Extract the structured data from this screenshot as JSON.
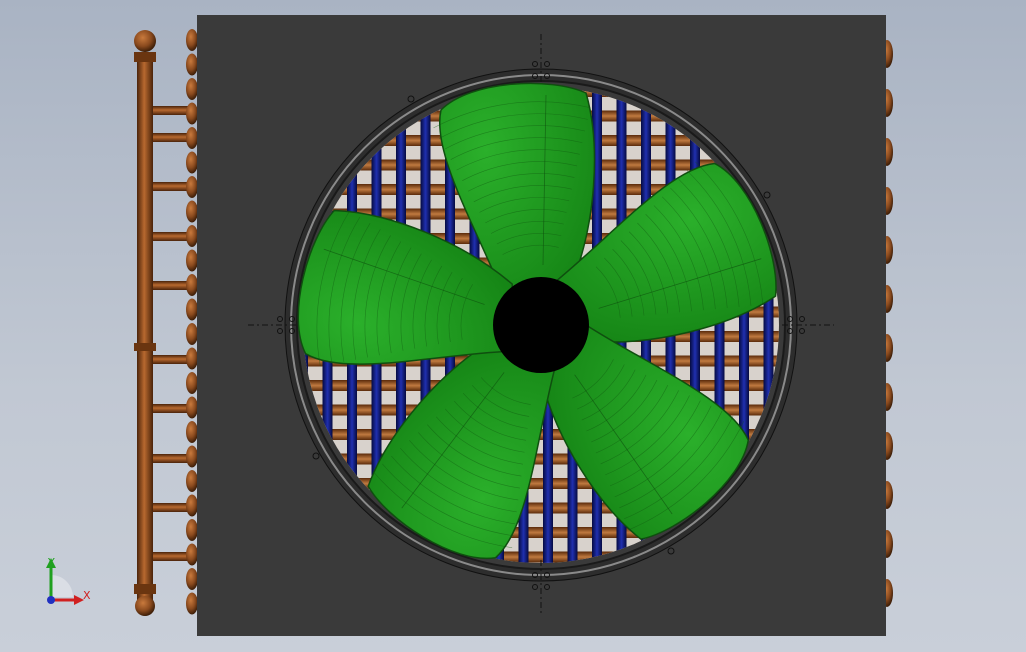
{
  "viewport": {
    "background_top": "#a9b3c3",
    "background_bottom": "#c9cfd9"
  },
  "model": {
    "panel_color": "#3a3a3a",
    "blade_color": "#1f9a1f",
    "blade_edge_color": "#0f4f0f",
    "hub_color": "#000000",
    "copper_color": "#8a4a1e",
    "tube_color": "#101a8a",
    "blade_count": 5
  },
  "triad": {
    "x_label": "X",
    "y_label": "Y",
    "x_color": "#d02020",
    "y_color": "#20a020",
    "z_color": "#2030c0"
  }
}
